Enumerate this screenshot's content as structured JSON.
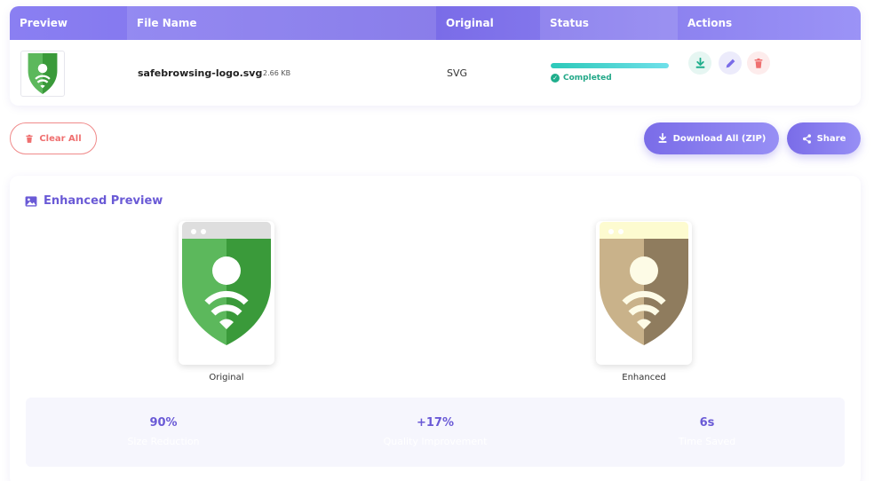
{
  "table": {
    "headers": [
      "Preview",
      "File Name",
      "Original",
      "Status",
      "Actions"
    ],
    "row": {
      "file_name": "safebrowsing-logo.svg",
      "file_size": "2.66 KB",
      "original_format": "SVG",
      "progress_percent": 100,
      "status": "Completed"
    }
  },
  "toolbar": {
    "clear_label": "Clear All",
    "download_zip_label": "Download All (ZIP)",
    "share_label": "Share"
  },
  "preview": {
    "title": "Enhanced Preview",
    "original_caption": "Original",
    "enhanced_caption": "Enhanced"
  },
  "stats": [
    {
      "value": "90%",
      "label": "Size Reduction"
    },
    {
      "value": "+17%",
      "label": "Quality Improvement"
    },
    {
      "value": "6s",
      "label": "Time Saved"
    }
  ],
  "colors": {
    "accent": "#7a6ce8",
    "success": "#1fae8c",
    "danger": "#ef6f6f",
    "shield_light": "#5cb85c",
    "shield_dark": "#3a9a3a",
    "enhanced_light": "#c9b28a",
    "enhanced_dark": "#8f7c5e"
  },
  "icons": {
    "download": "download-icon",
    "edit": "pencil-icon",
    "delete": "trash-icon",
    "image": "image-icon",
    "share": "share-icon"
  }
}
